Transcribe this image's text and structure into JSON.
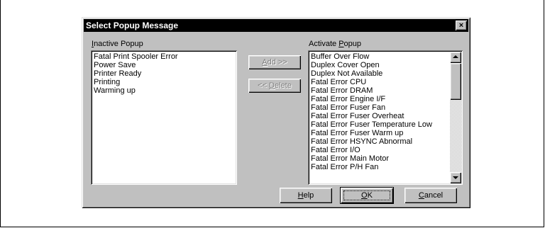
{
  "dialog": {
    "title": "Select Popup Message",
    "close_glyph": "×"
  },
  "inactive": {
    "label_mnemonic": "I",
    "label_rest": "nactive Popup",
    "items": [
      "Fatal Print Spooler Error",
      "Power Save",
      "Printer Ready",
      "Printing",
      "Warming up"
    ]
  },
  "active": {
    "label_pre": "Activate ",
    "label_mnemonic": "P",
    "label_rest": "opup",
    "items": [
      "Buffer Over Flow",
      "Duplex Cover Open",
      "Duplex Not Available",
      "Fatal Error CPU",
      "Fatal Error DRAM",
      "Fatal Error Engine I/F",
      "Fatal Error Fuser Fan",
      "Fatal Error Fuser Overheat",
      "Fatal Error Fuser Temperature Low",
      "Fatal Error Fuser Warm up",
      "Fatal Error HSYNC Abnormal",
      "Fatal Error I/O",
      "Fatal Error Main Motor",
      "Fatal Error P/H Fan"
    ]
  },
  "buttons": {
    "add_mnemonic": "A",
    "add_rest": "dd >>",
    "delete_pre": "<< ",
    "delete_mnemonic": "D",
    "delete_rest": "elete",
    "help_mnemonic": "H",
    "help_rest": "elp",
    "ok_mnemonic": "O",
    "ok_rest": "K",
    "cancel_mnemonic": "C",
    "cancel_rest": "ancel"
  },
  "icons": {
    "scroll_up": "scroll-up-arrow-icon",
    "scroll_down": "scroll-down-arrow-icon",
    "close": "close-icon"
  }
}
